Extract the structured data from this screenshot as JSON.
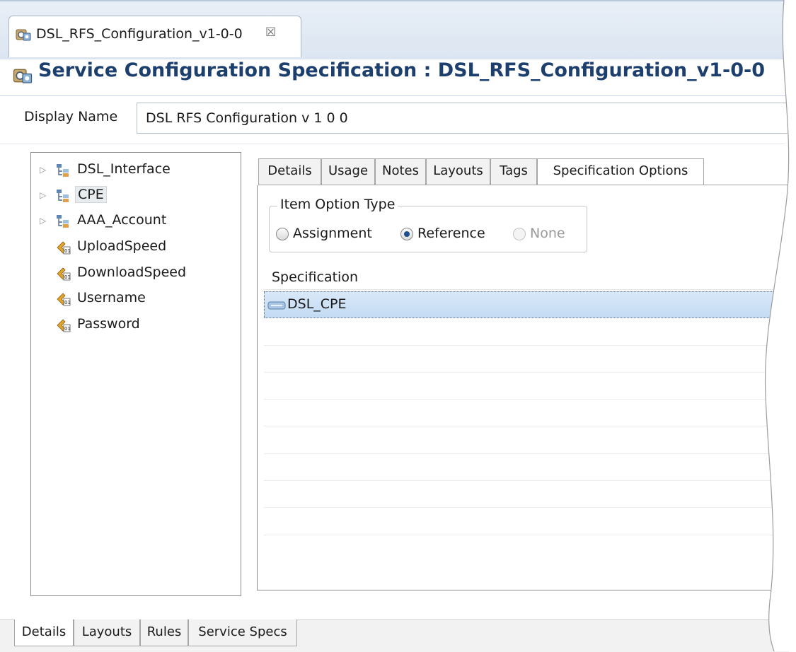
{
  "editor_tab": {
    "label": "DSL_RFS_Configuration_v1-0-0",
    "close_glyph": "☒",
    "icon": "spec-icon"
  },
  "header": {
    "title": "Service Configuration Specification : DSL_RFS_Configuration_v1-0-0",
    "icon": "spec-icon"
  },
  "display_name": {
    "label": "Display Name",
    "value": "DSL  RFS  Configuration  v 1  0  0"
  },
  "tree": {
    "items": [
      {
        "label": "DSL_Interface",
        "icon": "structure-icon",
        "expandable": true,
        "selected": false
      },
      {
        "label": "CPE",
        "icon": "structure-icon",
        "expandable": true,
        "selected": true
      },
      {
        "label": "AAA_Account",
        "icon": "structure-icon",
        "expandable": true,
        "selected": false
      },
      {
        "label": "UploadSpeed",
        "icon": "characteristic-icon",
        "expandable": false,
        "selected": false
      },
      {
        "label": "DownloadSpeed",
        "icon": "characteristic-icon",
        "expandable": false,
        "selected": false
      },
      {
        "label": "Username",
        "icon": "characteristic-icon",
        "expandable": false,
        "selected": false
      },
      {
        "label": "Password",
        "icon": "characteristic-icon",
        "expandable": false,
        "selected": false
      }
    ]
  },
  "panel_tabs": [
    {
      "label": "Details"
    },
    {
      "label": "Usage"
    },
    {
      "label": "Notes"
    },
    {
      "label": "Layouts"
    },
    {
      "label": "Tags"
    },
    {
      "label": "Specification Options",
      "active": true
    }
  ],
  "item_option": {
    "legend": "Item Option Type",
    "options": [
      {
        "label": "Assignment",
        "selected": false,
        "enabled": true
      },
      {
        "label": "Reference",
        "selected": true,
        "enabled": true
      },
      {
        "label": "None",
        "selected": false,
        "enabled": false
      }
    ]
  },
  "spec_table": {
    "header": "Specification",
    "rows": [
      {
        "label": "DSL_CPE",
        "icon": "specification-reference-icon"
      }
    ]
  },
  "bottom_tabs": [
    {
      "label": "Details",
      "active": true
    },
    {
      "label": "Layouts"
    },
    {
      "label": "Rules"
    },
    {
      "label": "Service Specs"
    }
  ],
  "colors": {
    "title": "#1d3f6e",
    "selection_row": "#c3dbf3",
    "tab_bar_bg": "#dbe5f1",
    "radio_selected": "#1b4f8d"
  }
}
